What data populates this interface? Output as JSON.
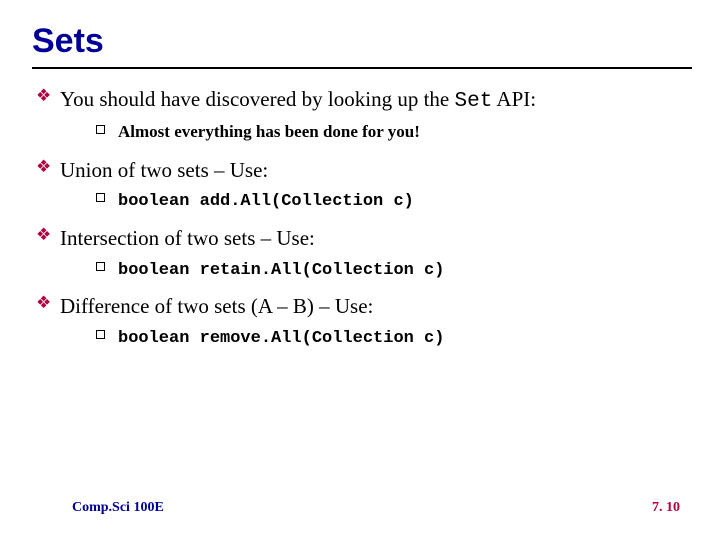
{
  "title": "Sets",
  "bullets": [
    {
      "pre": "You should have  discovered by looking up the ",
      "code": "Set",
      "post": " API:",
      "sub": {
        "pre": "Almost everything has been done for you!",
        "code": "",
        "post": ""
      }
    },
    {
      "pre": "Union  of two sets – Use:",
      "code": "",
      "post": "",
      "sub": {
        "pre": "",
        "code": "boolean add.All(Collection c)",
        "post": ""
      }
    },
    {
      "pre": "Intersection of two sets – Use:",
      "code": "",
      "post": "",
      "sub": {
        "pre": "",
        "code": "boolean retain.All(Collection c)",
        "post": ""
      }
    },
    {
      "pre": "Difference of two sets (A – B) – Use:",
      "code": "",
      "post": "",
      "sub": {
        "pre": "",
        "code": "boolean remove.All(Collection c)",
        "post": ""
      }
    }
  ],
  "footer": {
    "left": "Comp.Sci 100E",
    "right": "7. 10"
  }
}
